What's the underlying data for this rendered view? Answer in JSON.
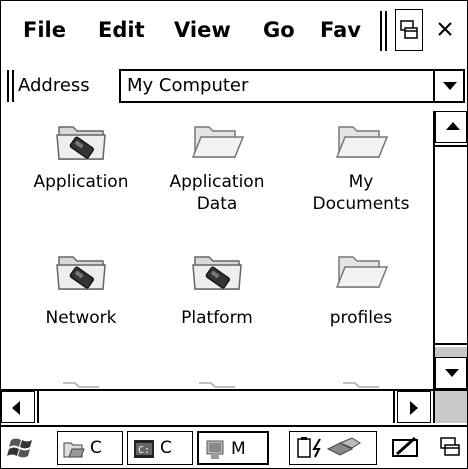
{
  "menubar": {
    "items": [
      "File",
      "Edit",
      "View",
      "Go",
      "Fav"
    ]
  },
  "address": {
    "label": "Address",
    "value": "My Computer"
  },
  "folders": [
    {
      "line1": "Application",
      "line2": "",
      "icon": "storage-folder-icon"
    },
    {
      "line1": "Application",
      "line2": "Data",
      "icon": "folder-icon"
    },
    {
      "line1": "My",
      "line2": "Documents",
      "icon": "folder-icon"
    },
    {
      "line1": "Network",
      "line2": "",
      "icon": "storage-folder-icon"
    },
    {
      "line1": "Platform",
      "line2": "",
      "icon": "storage-folder-icon"
    },
    {
      "line1": "profiles",
      "line2": "",
      "icon": "folder-icon"
    }
  ],
  "taskbar": {
    "tasks": [
      {
        "label": "C",
        "icon": "explorer-icon"
      },
      {
        "label": "C",
        "icon": "command-icon"
      },
      {
        "label": "M",
        "icon": "my-computer-icon"
      }
    ]
  }
}
